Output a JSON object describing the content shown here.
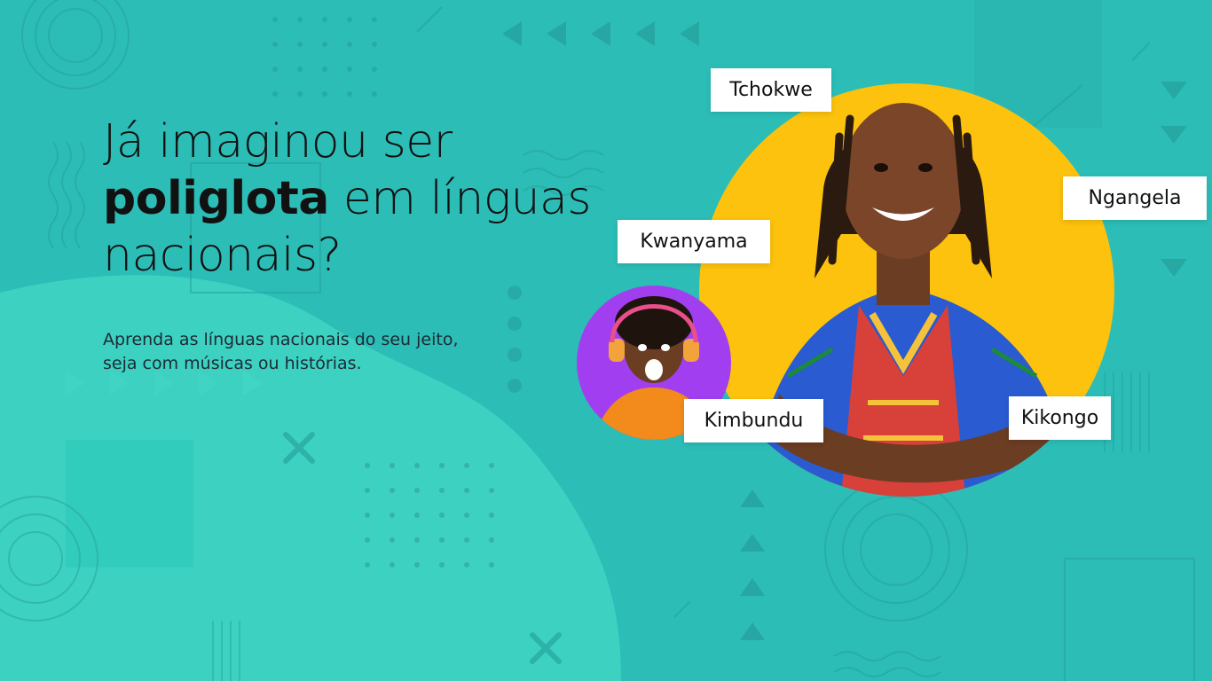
{
  "hero": {
    "headline_line1": "Já imaginou ser",
    "headline_bold": "poliglota",
    "headline_rest": " em línguas",
    "headline_line3": "nacionais?",
    "subtitle_line1": "Aprenda as línguas nacionais do seu jeito,",
    "subtitle_line2": "seja com músicas ou histórias."
  },
  "languages": [
    "Tchokwe",
    "Ngangela",
    "Kwanyama",
    "Kimbundu",
    "Kikongo"
  ],
  "colors": {
    "background": "#2cbdb7",
    "blob": "#3fd3c3",
    "big_circle": "#fcc20d",
    "small_circle": "#a13ff0",
    "tag_bg": "#ffffff",
    "text": "#111111"
  },
  "images": {
    "main_photo": "smiling-man-photo",
    "secondary_photo": "excited-woman-headphones-photo"
  }
}
